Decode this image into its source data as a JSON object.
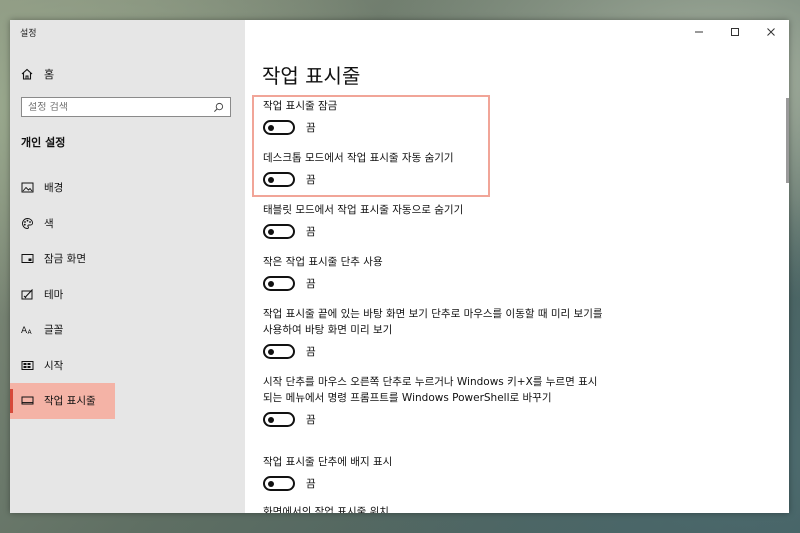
{
  "window": {
    "app_title": "설정"
  },
  "sidebar": {
    "home_label": "홈",
    "search_placeholder": "설정 검색",
    "section_title": "개인 설정",
    "items": [
      {
        "label": "배경",
        "icon": "image-icon"
      },
      {
        "label": "색",
        "icon": "palette-icon"
      },
      {
        "label": "잠금 화면",
        "icon": "lock-screen-icon"
      },
      {
        "label": "테마",
        "icon": "theme-icon"
      },
      {
        "label": "글꼴",
        "icon": "font-icon"
      },
      {
        "label": "시작",
        "icon": "start-icon"
      },
      {
        "label": "작업 표시줄",
        "icon": "taskbar-icon",
        "active": true
      }
    ]
  },
  "main": {
    "title": "작업 표시줄",
    "settings": [
      {
        "label": "작업 표시줄 잠금",
        "state": "끔",
        "on": false
      },
      {
        "label": "데스크톱 모드에서 작업 표시줄 자동 숨기기",
        "state": "끔",
        "on": false
      },
      {
        "label": "태블릿 모드에서 작업 표시줄 자동으로 숨기기",
        "state": "끔",
        "on": false
      },
      {
        "label": "작은 작업 표시줄 단추 사용",
        "state": "끔",
        "on": false
      },
      {
        "label": "작업 표시줄 끝에 있는 바탕 화면 보기 단추로 마우스를 이동할 때 미리 보기를 사용하여 바탕 화면 미리 보기",
        "state": "끔",
        "on": false
      },
      {
        "label": "시작 단추를 마우스 오른쪽 단추로 누르거나 Windows 키+X를 누르면 표시되는 메뉴에서 명령 프롬프트를 Windows PowerShell로 바꾸기",
        "state": "끔",
        "on": false
      },
      {
        "label": "작업 표시줄 단추에 배지 표시",
        "state": "끔",
        "on": false
      },
      {
        "label": "화면에서의 작업 표시줄 위치"
      }
    ]
  },
  "colors": {
    "accent": "#d64a3a",
    "highlight_border": "#f1a598",
    "active_nav_bg": "#f4b3a6"
  }
}
